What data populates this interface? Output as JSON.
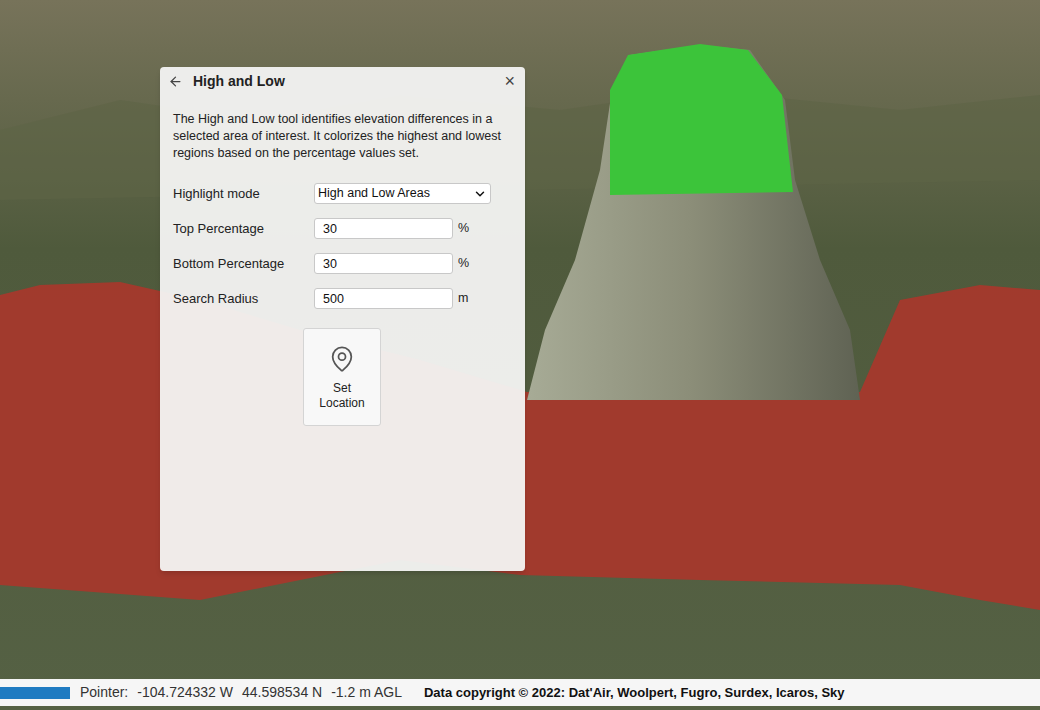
{
  "panel": {
    "title": "High and Low",
    "close": "×",
    "description": "The High and Low tool identifies elevation differences in a selected area of interest. It colorizes the highest and lowest regions based on the percentage values set.",
    "fields": [
      {
        "label": "Highlight mode",
        "kind": "select",
        "value": "High and Low Areas",
        "unit": ""
      },
      {
        "label": "Top Percentage",
        "kind": "input",
        "value": "30",
        "unit": "%"
      },
      {
        "label": "Bottom Percentage",
        "kind": "input",
        "value": "30",
        "unit": "%"
      },
      {
        "label": "Search Radius",
        "kind": "input",
        "value": "500",
        "unit": "m"
      }
    ],
    "action": {
      "label": "Set Location"
    }
  },
  "map": {
    "regions": [
      {
        "kind": "low",
        "color": "#a8372b"
      },
      {
        "kind": "high",
        "color": "#3cc43a"
      }
    ]
  },
  "status_bar": {
    "pointer_label": "Pointer:",
    "longitude": "-104.724332 W",
    "latitude": "44.598534 N",
    "altitude": "-1.2 m AGL",
    "copyright": "Data copyright © 2022: Dat'Air, Woolpert, Fugro, Surdex, Icaros, Sky"
  }
}
